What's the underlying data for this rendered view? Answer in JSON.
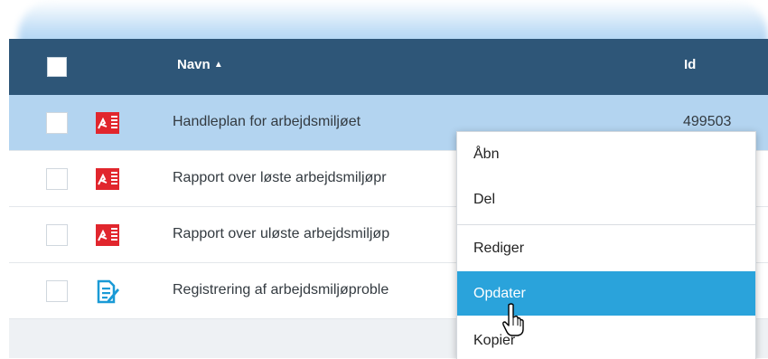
{
  "header": {
    "name_label": "Navn",
    "sort_indicator": "▲",
    "id_label": "Id"
  },
  "rows": [
    {
      "name": "Handleplan for arbejdsmiljøet",
      "id": "499503",
      "icon": "pdf-icon",
      "selected": true
    },
    {
      "name": "Rapport over løste arbejdsmiljøpr",
      "id": "",
      "icon": "pdf-icon",
      "selected": false
    },
    {
      "name": "Rapport over uløste arbejdsmiljøp",
      "id": "",
      "icon": "pdf-icon",
      "selected": false
    },
    {
      "name": "Registrering af arbejdsmiljøproble",
      "id": "",
      "icon": "form-edit-icon",
      "selected": false
    }
  ],
  "context_menu": {
    "items": [
      "Åbn",
      "Del",
      "Rediger",
      "Opdater",
      "Kopier"
    ],
    "active": "Opdater"
  },
  "colors": {
    "header_bg": "#2e5678",
    "selected_row": "#b3d4f0",
    "menu_active": "#2aa3db",
    "pdf_red": "#e1262d",
    "form_blue": "#1a9ad6"
  }
}
